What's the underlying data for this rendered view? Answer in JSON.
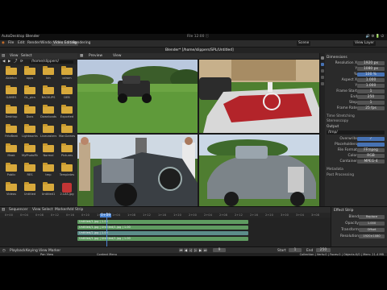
{
  "window": {
    "app_name": "AutoDesktop",
    "menu_label": "Blender",
    "center_title": "File 12:00 ⓘ",
    "right_status": "🔊 ⚙ 🔋 ⏻"
  },
  "topbar": {
    "menus": [
      "File",
      "Edit",
      "Render",
      "Window",
      "Help"
    ],
    "workspaces": [
      "Video Editing",
      "Rendering"
    ],
    "scene": "Scene",
    "view_layer": "View Layer"
  },
  "project_title": "Blender* [/home/slippers/SPL/Untitled]",
  "filebrowser": {
    "header": [
      "View",
      "Select"
    ],
    "path": "/home/slippers/",
    "items": [
      {
        "label": "Ableton",
        "kind": "folder"
      },
      {
        "label": "apps",
        "kind": "folder"
      },
      {
        "label": "bin",
        "kind": "folder"
      },
      {
        "label": "cdrom",
        "kind": "folder"
      },
      {
        "label": "GAMES",
        "kind": "folder"
      },
      {
        "label": "GL_pics",
        "kind": "folder"
      },
      {
        "label": "BACKUPS",
        "kind": "folder"
      },
      {
        "label": "DEB",
        "kind": "folder"
      },
      {
        "label": "Desktop",
        "kind": "folder"
      },
      {
        "label": "Docs",
        "kind": "folder"
      },
      {
        "label": "Downloads",
        "kind": "folder"
      },
      {
        "label": "Exported",
        "kind": "folder"
      },
      {
        "label": "FritzBeat",
        "kind": "folder"
      },
      {
        "label": "Lightworks",
        "kind": "folder"
      },
      {
        "label": "Livecasters",
        "kind": "folder"
      },
      {
        "label": "ManGames",
        "kind": "folder"
      },
      {
        "label": "Mask",
        "kind": "folder"
      },
      {
        "label": "MyPhotoFile",
        "kind": "folder"
      },
      {
        "label": "Normal",
        "kind": "folder"
      },
      {
        "label": "Pictures",
        "kind": "folder"
      },
      {
        "label": "Public",
        "kind": "folder"
      },
      {
        "label": "RES",
        "kind": "folder"
      },
      {
        "label": "tmp",
        "kind": "folder"
      },
      {
        "label": "Templates",
        "kind": "folder"
      },
      {
        "label": "Videos",
        "kind": "folder"
      },
      {
        "label": "Untitled",
        "kind": "folder"
      },
      {
        "label": "Untitled1",
        "kind": "folder"
      },
      {
        "label": "2.LAS.jpg",
        "kind": "image"
      }
    ]
  },
  "viewer": {
    "header": [
      "Preview",
      "View"
    ]
  },
  "properties": {
    "section_dimensions": "Dimensions",
    "rows": [
      {
        "label": "Resolution X",
        "value": "1920 px"
      },
      {
        "label": "Y",
        "value": "1080 px"
      },
      {
        "label": "%",
        "value": "100 %"
      },
      {
        "label": "Aspect X",
        "value": "1.000"
      },
      {
        "label": "Y",
        "value": "1.000"
      },
      {
        "label": "Frame Start",
        "value": "1"
      },
      {
        "label": "End",
        "value": "250"
      },
      {
        "label": "Step",
        "value": "1"
      },
      {
        "label": "Frame Rate",
        "value": "25 fps"
      }
    ],
    "section_output": "Output",
    "output_path": "/tmp/",
    "output_rows": [
      {
        "label": "Overwrite",
        "value": "✓"
      },
      {
        "label": "Placeholders",
        "value": ""
      },
      {
        "label": "File Format",
        "value": "FFmpeg"
      },
      {
        "label": "Color",
        "value": "RGB"
      },
      {
        "label": "Container",
        "value": "MPEG-4"
      }
    ],
    "section_time_stretching": "Time Stretching",
    "section_stereoscopy": "Stereoscopy",
    "section_metadata": "Metadata",
    "section_post_processing": "Post Processing"
  },
  "sequencer": {
    "header": [
      "Sequencer",
      "View",
      "Select",
      "Marker",
      "Add",
      "Strip"
    ],
    "ticks": [
      "0+00",
      "0+04",
      "0+08",
      "0+12",
      "0+16",
      "0+20",
      "1+00",
      "1+04",
      "1+08",
      "1+12",
      "1+16",
      "1+20",
      "2+00",
      "2+04",
      "2+08",
      "2+12",
      "2+16",
      "2+20",
      "3+00",
      "3+04",
      "3+08"
    ],
    "current_frame_label": "0+09",
    "strips": [
      {
        "label": "Untitled/1.jpg | 1.00",
        "kind": "green"
      },
      {
        "label": "Untitled/1.jpg | Untitled/1.jpg | 1.00",
        "kind": "green"
      },
      {
        "label": "Untitled/2.jpg | 1.00",
        "kind": "sound"
      },
      {
        "label": "Untitled/1.jpg | Untitled/1.jpg | 1.00",
        "kind": "green"
      }
    ],
    "side_header": "Effect Strip",
    "side_rows": [
      {
        "label": "Blend",
        "value": "Replace"
      },
      {
        "label": "Opacity",
        "value": "1.000"
      },
      {
        "label": "Transform",
        "value": "Offset"
      },
      {
        "label": "Resolution",
        "value": "1920×1080"
      }
    ]
  },
  "timeline": {
    "menus": [
      "Playback",
      "Keying",
      "View",
      "Marker"
    ],
    "frame": "9",
    "start_label": "Start",
    "start": "1",
    "end_label": "End",
    "end": "250"
  },
  "statusbar": {
    "left": "Pan View",
    "middle": "Context Menu",
    "right": "Collection | Verts:0 | Faces:0 | Objects:0/0 | Mem: 21.4 MB"
  },
  "colors": {
    "accent": "#4772b3",
    "folder": "#d8a93b",
    "strip_green": "#5f9b61",
    "strip_sound": "#5c8d8a"
  }
}
